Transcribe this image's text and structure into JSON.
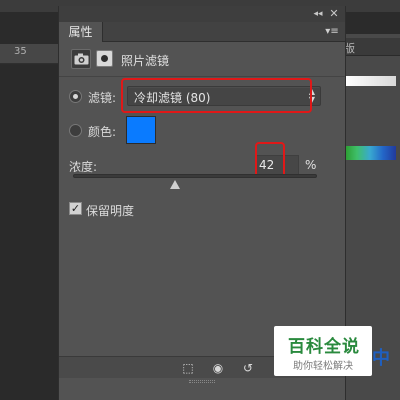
{
  "background": {
    "ruler_label": "35",
    "right_panel_tab": "版",
    "right_bottom_text": "中"
  },
  "panel": {
    "tab_label": "属性",
    "title": "照片滤镜",
    "filter": {
      "label": "滤镜:",
      "selected": true,
      "value": "冷却滤镜 (80)"
    },
    "color": {
      "label": "颜色:",
      "selected": false,
      "swatch": "#0a7bff"
    },
    "density": {
      "label": "浓度:",
      "value": "42",
      "unit": "%",
      "percent": 42
    },
    "preserve_luminosity": {
      "label": "保留明度",
      "checked": true
    },
    "toolbar_icons": [
      "clip-to-layer-icon",
      "visibility-toggle-icon",
      "reset-icon"
    ]
  },
  "annotation_color": "#e01818",
  "watermark": {
    "main": "百科全说",
    "sub": "助你轻松解决"
  }
}
